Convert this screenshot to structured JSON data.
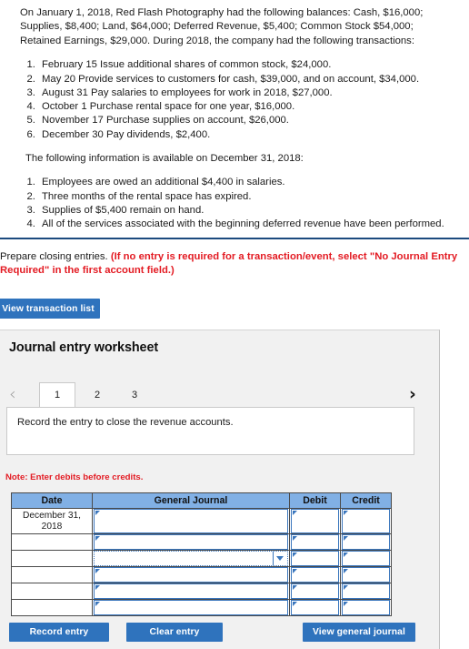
{
  "problem": {
    "intro": "On January 1, 2018, Red Flash Photography had the following balances: Cash, $16,000; Supplies, $8,400; Land, $64,000; Deferred Revenue, $5,400; Common Stock $54,000; Retained Earnings, $29,000. During 2018, the company had the following transactions:",
    "transactions": [
      "February 15 Issue additional shares of common stock, $24,000.",
      "May 20 Provide services to customers for cash, $39,000, and on account, $34,000.",
      "August 31 Pay salaries to employees for work in 2018, $27,000.",
      "October 1 Purchase rental space for one year, $16,000.",
      "November 17 Purchase supplies on account, $26,000.",
      "December 30 Pay dividends, $2,400."
    ],
    "available_heading": "The following information is available on December 31, 2018:",
    "adjustments": [
      "Employees are owed an additional $4,400 in salaries.",
      "Three months of the rental space has expired.",
      "Supplies of $5,400 remain on hand.",
      "All of the services associated with the beginning deferred revenue have been performed."
    ]
  },
  "prompt": {
    "lead": "Prepare closing entries.",
    "red_note": "(If no entry is required for a transaction/event, select \"No Journal Entry Required\" in the first account field.)"
  },
  "buttons": {
    "view_transaction_list": "View transaction list",
    "record_entry": "Record entry",
    "clear_entry": "Clear entry",
    "view_general_journal": "View general journal"
  },
  "worksheet": {
    "title": "Journal entry worksheet",
    "tabs": [
      {
        "label": "1",
        "active": true
      },
      {
        "label": "2",
        "active": false
      },
      {
        "label": "3",
        "active": false
      }
    ],
    "prev_icon": "chevron-left-icon",
    "next_icon": "chevron-right-icon",
    "instruction": "Record the entry to close the revenue accounts.",
    "note": "Note: Enter debits before credits."
  },
  "table": {
    "headers": [
      "Date",
      "General Journal",
      "Debit",
      "Credit"
    ],
    "rows": [
      {
        "date": "December 31, 2018",
        "general_journal": "",
        "debit": "",
        "credit": "",
        "focused": false
      },
      {
        "date": "",
        "general_journal": "",
        "debit": "",
        "credit": "",
        "focused": false
      },
      {
        "date": "",
        "general_journal": "",
        "debit": "",
        "credit": "",
        "focused": true
      },
      {
        "date": "",
        "general_journal": "",
        "debit": "",
        "credit": "",
        "focused": false
      },
      {
        "date": "",
        "general_journal": "",
        "debit": "",
        "credit": "",
        "focused": false
      },
      {
        "date": "",
        "general_journal": "",
        "debit": "",
        "credit": "",
        "focused": false
      }
    ]
  },
  "colors": {
    "button_blue": "#2f73bd",
    "header_blue": "#81b0e5",
    "red": "#e31b23",
    "divider_navy": "#1c4a7e",
    "panel_bg": "#f1f1f1",
    "cell_border_blue": "#3a76bd"
  }
}
